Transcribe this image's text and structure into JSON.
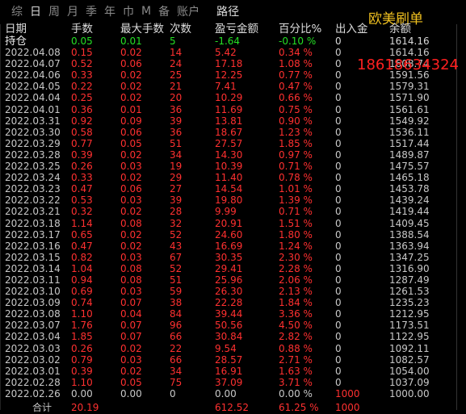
{
  "tabs": [
    {
      "label": "综",
      "active": false
    },
    {
      "label": "日",
      "active": true
    },
    {
      "label": "周",
      "active": false
    },
    {
      "label": "月",
      "active": false
    },
    {
      "label": "季",
      "active": false
    },
    {
      "label": "年",
      "active": false
    },
    {
      "label": "巾",
      "active": false
    },
    {
      "label": "M",
      "active": false
    },
    {
      "label": "备",
      "active": false
    },
    {
      "label": "账户",
      "active": false
    },
    {
      "label": "路径",
      "active": false
    }
  ],
  "watermark": "欧美刷单",
  "phone_overlay": "18618634324",
  "columns": [
    "日期",
    "手数",
    "最大手数",
    "次数",
    "盈亏金额",
    "百分比%",
    "出入金",
    "余额"
  ],
  "holding": {
    "label": "持仓",
    "lots": "0.05",
    "max_lots": "0.01",
    "count": "5",
    "pnl": "-1.64",
    "pct": "-0.10 %",
    "io": "0",
    "balance": "1614.16"
  },
  "rows": [
    {
      "date": "2022.04.08",
      "lots": "0.15",
      "max_lots": "0.02",
      "count": "14",
      "pnl": "5.42",
      "pct": "0.34 %",
      "io": "0",
      "balance": "1614.16"
    },
    {
      "date": "2022.04.07",
      "lots": "0.52",
      "max_lots": "0.06",
      "count": "24",
      "pnl": "17.18",
      "pct": "1.08 %",
      "io": "0",
      "balance": "1608.74"
    },
    {
      "date": "2022.04.06",
      "lots": "0.33",
      "max_lots": "0.02",
      "count": "25",
      "pnl": "12.25",
      "pct": "0.77 %",
      "io": "0",
      "balance": "1591.56"
    },
    {
      "date": "2022.04.05",
      "lots": "0.22",
      "max_lots": "0.02",
      "count": "21",
      "pnl": "7.41",
      "pct": "0.47 %",
      "io": "0",
      "balance": "1579.31"
    },
    {
      "date": "2022.04.04",
      "lots": "0.25",
      "max_lots": "0.02",
      "count": "20",
      "pnl": "10.29",
      "pct": "0.66 %",
      "io": "0",
      "balance": "1571.90"
    },
    {
      "date": "2022.04.01",
      "lots": "0.36",
      "max_lots": "0.01",
      "count": "36",
      "pnl": "11.69",
      "pct": "0.75 %",
      "io": "0",
      "balance": "1561.61"
    },
    {
      "date": "2022.03.31",
      "lots": "0.92",
      "max_lots": "0.09",
      "count": "39",
      "pnl": "13.81",
      "pct": "0.90 %",
      "io": "0",
      "balance": "1549.92"
    },
    {
      "date": "2022.03.30",
      "lots": "0.58",
      "max_lots": "0.06",
      "count": "36",
      "pnl": "18.67",
      "pct": "1.23 %",
      "io": "0",
      "balance": "1536.11"
    },
    {
      "date": "2022.03.29",
      "lots": "0.77",
      "max_lots": "0.05",
      "count": "51",
      "pnl": "27.57",
      "pct": "1.85 %",
      "io": "0",
      "balance": "1517.44"
    },
    {
      "date": "2022.03.28",
      "lots": "0.39",
      "max_lots": "0.02",
      "count": "34",
      "pnl": "14.30",
      "pct": "0.97 %",
      "io": "0",
      "balance": "1489.87"
    },
    {
      "date": "2022.03.25",
      "lots": "0.26",
      "max_lots": "0.03",
      "count": "19",
      "pnl": "10.39",
      "pct": "0.71 %",
      "io": "0",
      "balance": "1475.57"
    },
    {
      "date": "2022.03.24",
      "lots": "0.33",
      "max_lots": "0.02",
      "count": "29",
      "pnl": "11.40",
      "pct": "0.78 %",
      "io": "0",
      "balance": "1465.18"
    },
    {
      "date": "2022.03.23",
      "lots": "0.47",
      "max_lots": "0.06",
      "count": "27",
      "pnl": "14.54",
      "pct": "1.01 %",
      "io": "0",
      "balance": "1453.78"
    },
    {
      "date": "2022.03.22",
      "lots": "0.53",
      "max_lots": "0.03",
      "count": "39",
      "pnl": "19.80",
      "pct": "1.39 %",
      "io": "0",
      "balance": "1439.24"
    },
    {
      "date": "2022.03.21",
      "lots": "0.32",
      "max_lots": "0.02",
      "count": "28",
      "pnl": "9.99",
      "pct": "0.71 %",
      "io": "0",
      "balance": "1419.44"
    },
    {
      "date": "2022.03.18",
      "lots": "1.14",
      "max_lots": "0.08",
      "count": "32",
      "pnl": "20.91",
      "pct": "1.51 %",
      "io": "0",
      "balance": "1409.45"
    },
    {
      "date": "2022.03.17",
      "lots": "0.65",
      "max_lots": "0.02",
      "count": "52",
      "pnl": "24.60",
      "pct": "1.80 %",
      "io": "0",
      "balance": "1388.54"
    },
    {
      "date": "2022.03.16",
      "lots": "0.47",
      "max_lots": "0.02",
      "count": "43",
      "pnl": "16.69",
      "pct": "1.24 %",
      "io": "0",
      "balance": "1363.94"
    },
    {
      "date": "2022.03.15",
      "lots": "0.82",
      "max_lots": "0.03",
      "count": "67",
      "pnl": "30.35",
      "pct": "2.30 %",
      "io": "0",
      "balance": "1347.25"
    },
    {
      "date": "2022.03.14",
      "lots": "1.04",
      "max_lots": "0.08",
      "count": "52",
      "pnl": "29.41",
      "pct": "2.28 %",
      "io": "0",
      "balance": "1316.90"
    },
    {
      "date": "2022.03.11",
      "lots": "0.94",
      "max_lots": "0.08",
      "count": "51",
      "pnl": "25.96",
      "pct": "2.06 %",
      "io": "0",
      "balance": "1287.49"
    },
    {
      "date": "2022.03.10",
      "lots": "0.69",
      "max_lots": "0.03",
      "count": "59",
      "pnl": "26.30",
      "pct": "2.13 %",
      "io": "0",
      "balance": "1261.53"
    },
    {
      "date": "2022.03.09",
      "lots": "0.74",
      "max_lots": "0.07",
      "count": "38",
      "pnl": "22.28",
      "pct": "1.84 %",
      "io": "0",
      "balance": "1235.23"
    },
    {
      "date": "2022.03.08",
      "lots": "1.10",
      "max_lots": "0.04",
      "count": "84",
      "pnl": "39.44",
      "pct": "3.36 %",
      "io": "0",
      "balance": "1212.95"
    },
    {
      "date": "2022.03.07",
      "lots": "1.76",
      "max_lots": "0.07",
      "count": "96",
      "pnl": "50.56",
      "pct": "4.50 %",
      "io": "0",
      "balance": "1173.51"
    },
    {
      "date": "2022.03.04",
      "lots": "1.85",
      "max_lots": "0.07",
      "count": "66",
      "pnl": "30.84",
      "pct": "2.82 %",
      "io": "0",
      "balance": "1122.95"
    },
    {
      "date": "2022.03.03",
      "lots": "0.26",
      "max_lots": "0.02",
      "count": "22",
      "pnl": "9.54",
      "pct": "0.88 %",
      "io": "0",
      "balance": "1092.11"
    },
    {
      "date": "2022.03.02",
      "lots": "0.79",
      "max_lots": "0.03",
      "count": "66",
      "pnl": "28.57",
      "pct": "2.71 %",
      "io": "0",
      "balance": "1082.57"
    },
    {
      "date": "2022.03.01",
      "lots": "0.39",
      "max_lots": "0.02",
      "count": "34",
      "pnl": "16.91",
      "pct": "1.63 %",
      "io": "0",
      "balance": "1054.00"
    },
    {
      "date": "2022.02.28",
      "lots": "1.10",
      "max_lots": "0.05",
      "count": "75",
      "pnl": "37.09",
      "pct": "3.71 %",
      "io": "0",
      "balance": "1037.09"
    },
    {
      "date": "2022.02.26",
      "lots": "0.00",
      "max_lots": "0.00",
      "count": "0",
      "pnl": "0.00",
      "pct": "0.00 %",
      "io": "1000",
      "balance": "1000.00"
    }
  ],
  "total": {
    "label": "合计",
    "lots": "20.19",
    "pnl": "612.52",
    "pct": "61.25 %",
    "io": "1000"
  },
  "colors": {
    "profit": "#ff3030",
    "holding": "#25e025",
    "text": "#c8c8c8",
    "background": "#000000",
    "watermark": "#f0c020"
  }
}
